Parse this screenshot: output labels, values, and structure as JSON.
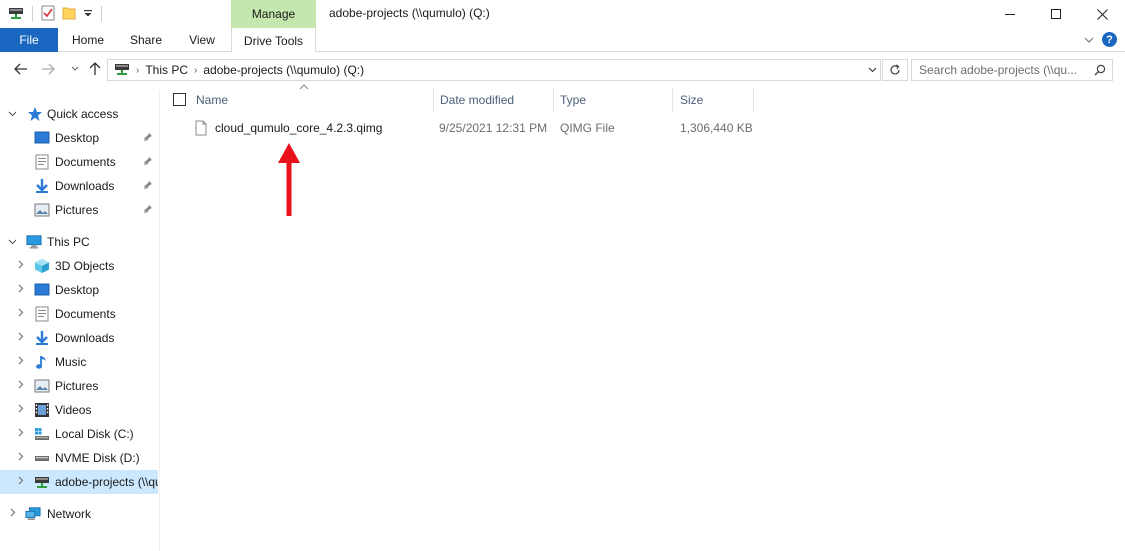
{
  "window": {
    "title": "adobe-projects (\\\\qumulo) (Q:)",
    "context_tab": "Manage"
  },
  "ribbon": {
    "tabs": [
      "File",
      "Home",
      "Share",
      "View",
      "Drive Tools"
    ]
  },
  "address": {
    "segments": [
      "This PC",
      "adobe-projects (\\\\qumulo) (Q:)"
    ]
  },
  "search": {
    "placeholder": "Search adobe-projects (\\\\qu..."
  },
  "nav": {
    "quick_access": {
      "label": "Quick access",
      "items": [
        "Desktop",
        "Documents",
        "Downloads",
        "Pictures"
      ]
    },
    "this_pc": {
      "label": "This PC",
      "items": [
        "3D Objects",
        "Desktop",
        "Documents",
        "Downloads",
        "Music",
        "Pictures",
        "Videos",
        "Local Disk (C:)",
        "NVME Disk (D:)",
        "adobe-projects (\\\\qumulo) (Q:)"
      ]
    },
    "network": {
      "label": "Network"
    }
  },
  "columns": {
    "name": "Name",
    "date": "Date modified",
    "type": "Type",
    "size": "Size"
  },
  "files": [
    {
      "name": "cloud_qumulo_core_4.2.3.qimg",
      "date": "9/25/2021 12:31 PM",
      "type": "QIMG File",
      "size": "1,306,440 KB"
    }
  ],
  "colors": {
    "file_tab": "#1a67c2",
    "manage_tab": "#c4e7ad",
    "selected": "#cce8ff",
    "annotation_arrow": "#e8111b"
  }
}
